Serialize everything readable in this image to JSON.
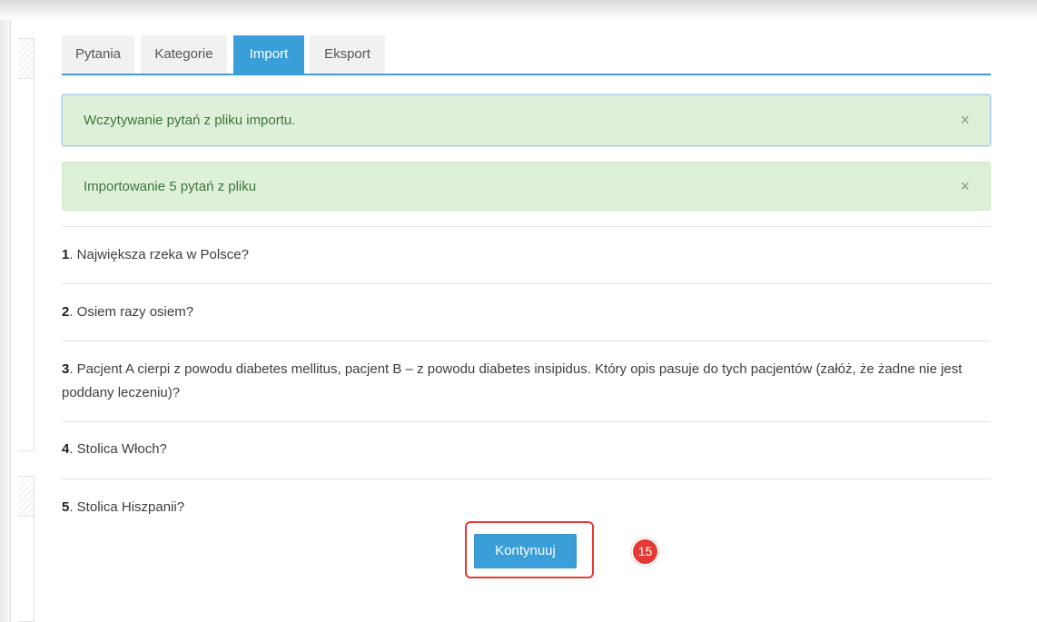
{
  "tabs": [
    {
      "label": "Pytania",
      "active": false
    },
    {
      "label": "Kategorie",
      "active": false
    },
    {
      "label": "Import",
      "active": true
    },
    {
      "label": "Eksport",
      "active": false
    }
  ],
  "alerts": [
    {
      "text": "Wczytywanie pytań z pliku importu.",
      "close_icon": "×",
      "icon_name": "close-icon"
    },
    {
      "text": "Importowanie 5 pytań z pliku",
      "close_icon": "×",
      "icon_name": "close-icon"
    }
  ],
  "questions": [
    {
      "number": "1",
      "text": ". Największa rzeka w Polsce?"
    },
    {
      "number": "2",
      "text": ". Osiem razy osiem?"
    },
    {
      "number": "3",
      "text": ". Pacjent A cierpi z powodu diabetes mellitus, pacjent B – z powodu diabetes insipidus. Który opis pasuje do tych pacjentów (załóż, że żadne nie jest poddany leczeniu)?"
    },
    {
      "number": "4",
      "text": ". Stolica Włoch?"
    },
    {
      "number": "5",
      "text": ". Stolica Hiszpanii?"
    }
  ],
  "actions": {
    "continue_label": "Kontynuuj",
    "step_badge": "15"
  },
  "colors": {
    "accent": "#3a9ed9",
    "success_background": "#dff0d8",
    "highlight": "#e53935"
  }
}
